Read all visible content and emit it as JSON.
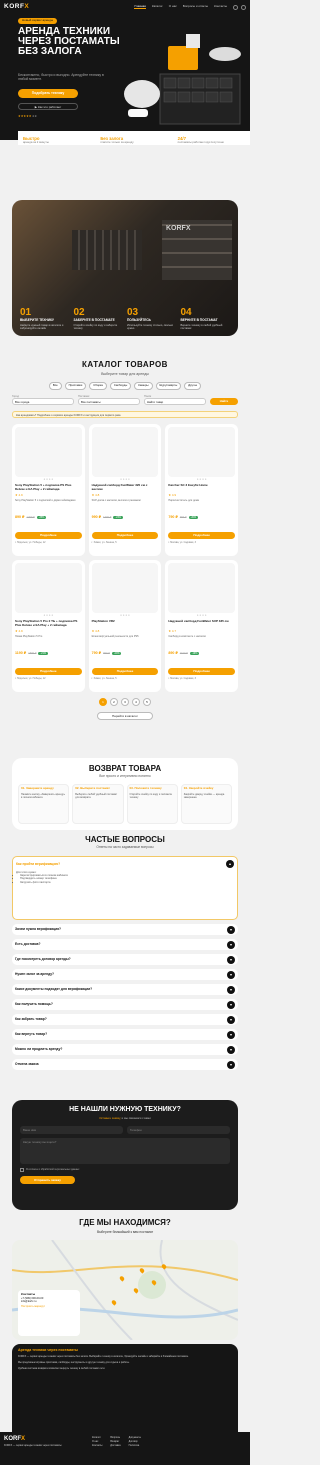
{
  "header": {
    "logo_a": "KORF",
    "logo_b": "X",
    "nav": [
      "Главная",
      "Каталог",
      "О нас",
      "Вопросы и ответы",
      "Контакты"
    ]
  },
  "hero": {
    "pill": "Новый сервис аренды",
    "title": "Аренда техники через постаматы без залога",
    "subtitle": "Бесконтактно, быстро и выгодно. Арендуйте технику в любой момент.",
    "btn1": "Подобрать технику",
    "btn2": "▶ Как это работает",
    "rating": "★★★★★",
    "rating_text": "4.9",
    "cards": [
      {
        "title": "Быстро",
        "text": "аренда за 2 минуты"
      },
      {
        "title": "Без залога",
        "text": "платите только за аренду"
      },
      {
        "title": "24/7",
        "text": "постаматы работают круглосуточно"
      }
    ]
  },
  "gallery": {
    "caption": "KORFX",
    "steps": [
      {
        "n": "01",
        "t": "Выберите технику",
        "d": "Найдите нужный товар в каталоге и забронируйте онлайн"
      },
      {
        "n": "02",
        "t": "Заберите в постамате",
        "d": "Откройте ячейку по коду и заберите технику"
      },
      {
        "n": "03",
        "t": "Пользуйтесь",
        "d": "Используйте технику столько, сколько нужно"
      },
      {
        "n": "04",
        "t": "Верните в постамат",
        "d": "Верните технику в любой удобный постамат"
      }
    ]
  },
  "catalog": {
    "title": "Каталог товаров",
    "subtitle": "Выберите товар для аренды",
    "categories": [
      "Все",
      "Приставки",
      "Сборка",
      "Сапборды",
      "Камеры",
      "Шуруповёрты",
      "Другое"
    ],
    "filter": {
      "city_label": "Город",
      "city": "Все города",
      "station_label": "Постамат",
      "station": "Все постаматы",
      "search_label": "Поиск",
      "search": "Найти товар",
      "btn": "Найти"
    },
    "info": "Как арендовать? Подробнее о сервисе аренды KORFX и инструкция для первого раза",
    "products": [
      {
        "name": "Sony PlayStation 5 + подписка PS Plus Deluxe и EA Play + 2 геймпада",
        "rating": "★ 4.9",
        "desc": "Sony PlayStation 5 с подпиской и двумя геймпадами",
        "price": "890 ₽",
        "old": "1200 ₽",
        "disc": "-25%",
        "btn": "Подробнее",
        "loc": "г. Подольск, ул. Победы, 12",
        "color": "#f5f5f7"
      },
      {
        "name": "Надувной сапборд FunWater 320 см с веслом",
        "rating": "★ 4.8",
        "desc": "SUP-доска с насосом, веслом и рюкзаком",
        "price": "990 ₽",
        "old": "1300 ₽",
        "disc": "-24%",
        "btn": "Подробнее",
        "loc": "г. Химки, ул. Ленина, 5",
        "color": "#f5f5f7"
      },
      {
        "name": "Karcher SC 3 Easyfix Home",
        "rating": "★ 4.9",
        "desc": "Пароочиститель для дома",
        "price": "790 ₽",
        "old": "990 ₽",
        "disc": "-20%",
        "btn": "Подробнее",
        "loc": "г. Москва, ул. Садовая, 3",
        "color": "#f5f5f7"
      },
      {
        "name": "Sony PlayStation 5 Pro 2 ТБ + подписка PS Plus Deluxe и EA Play + 2 геймпада",
        "rating": "★ 4.9",
        "desc": "Новая PlayStation 5 Pro",
        "price": "1190 ₽",
        "old": "1500 ₽",
        "disc": "-21%",
        "btn": "Подробнее",
        "loc": "г. Подольск, ул. Победы, 12",
        "color": "#f5f5f7"
      },
      {
        "name": "PlayStation VR2",
        "rating": "★ 4.8",
        "desc": "Шлем виртуальной реальности для PS5",
        "price": "790 ₽",
        "old": "990 ₽",
        "disc": "-20%",
        "btn": "Подробнее",
        "loc": "г. Химки, ул. Ленина, 5",
        "color": "#f5f5f7"
      },
      {
        "name": "Надувной сапборд FunWater SUP 335 см",
        "rating": "★ 4.7",
        "desc": "Сапборд в комплекте с насосом",
        "price": "890 ₽",
        "old": "1100 ₽",
        "disc": "-19%",
        "btn": "Подробнее",
        "loc": "г. Москва, ул. Садовая, 3",
        "color": "#f5f5f7"
      }
    ],
    "pages": [
      "1",
      "2",
      "3",
      "4",
      "5"
    ],
    "more": "Перейти в каталог"
  },
  "return": {
    "title": "Возврат товара",
    "subtitle": "Все просто и интуитивно понятно",
    "steps": [
      {
        "t": "01. Завершите аренду",
        "d": "Нажмите кнопку «Завершить аренду» в личном кабинете"
      },
      {
        "t": "02. Выберите постамат",
        "d": "Выберите любой удобный постамат для возврата"
      },
      {
        "t": "03. Положите технику",
        "d": "Откройте ячейку по коду и положите технику"
      },
      {
        "t": "04. Закройте ячейку",
        "d": "Закройте дверцу ячейки — аренда завершена"
      }
    ]
  },
  "faq": {
    "title": "Частые вопросы",
    "subtitle": "Ответы на часто задаваемые вопросы",
    "open_q": "Как пройти верификацию?",
    "open_a": [
      "Для этого нужно:",
      "Зарегистрироваться в личном кабинете",
      "Подтвердить номер телефона",
      "Загрузить фото паспорта"
    ],
    "items": [
      "Зачем нужна верификация?",
      "Есть доставка?",
      "Где посмотреть договор аренды?",
      "Нужен залог за аренду?",
      "Какие документы подходят для верификации?",
      "Как получить помощь?",
      "Как забрать товар?",
      "Как вернуть товар?",
      "Можно ли продлить аренду?",
      "Отмена заказа"
    ]
  },
  "request": {
    "title": "Не нашли нужную технику?",
    "sub_a": "Оставьте заявку,",
    "sub_b": "и мы свяжемся с вами",
    "name": "Ваше имя",
    "phone": "Телефон",
    "message": "Какую технику вы ищете?",
    "consent": "Я согласен с обработкой персональных данных",
    "btn": "Отправить заявку"
  },
  "map": {
    "title": "Где мы находимся?",
    "subtitle": "Выберите ближайший к вам постамат",
    "box_t": "Контакты",
    "box_phone": "+7 (999) 000-00-00",
    "box_mail": "info@korfx.ru",
    "box_link": "Построить маршрут"
  },
  "seo": {
    "title": "Аренда техники через постаматы",
    "p": [
      "KORFX — сервис аренды техники через постаматы без залога. Выбирайте технику в каталоге, бронируйте онлайн и забирайте в ближайшем постамате.",
      "Мы предлагаем игровые приставки, сапборды, инструменты и другую технику для отдыха и работы.",
      "Удобная система возврата позволяет вернуть технику в любой постамат сети."
    ]
  },
  "footer": {
    "logo_a": "KORF",
    "logo_b": "X",
    "about": "KORFX — сервис аренды техники через постаматы",
    "c1": [
      "Каталог",
      "О нас",
      "Контакты"
    ],
    "c2": [
      "Вопросы",
      "Возврат",
      "Доставка"
    ],
    "c3": [
      "Документы",
      "Договор",
      "Политика"
    ]
  }
}
